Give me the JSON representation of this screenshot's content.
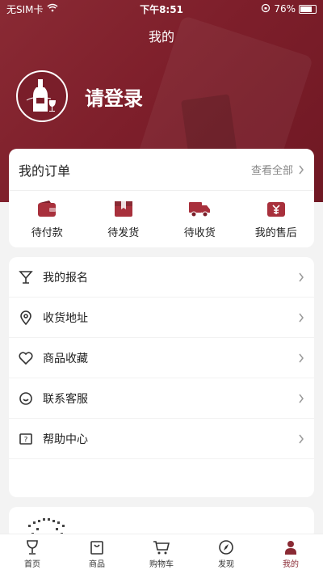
{
  "status_bar": {
    "carrier": "无SIM卡",
    "time": "下午8:51",
    "battery": "76%"
  },
  "header": {
    "title": "我的"
  },
  "profile": {
    "login_text": "请登录"
  },
  "orders": {
    "title": "我的订单",
    "view_all": "查看全部",
    "items": [
      {
        "label": "待付款",
        "icon": "wallet-icon"
      },
      {
        "label": "待发货",
        "icon": "box-icon"
      },
      {
        "label": "待收货",
        "icon": "truck-icon"
      },
      {
        "label": "我的售后",
        "icon": "yen-icon"
      }
    ]
  },
  "menu": {
    "items": [
      {
        "label": "我的报名",
        "icon": "cocktail-glass-icon"
      },
      {
        "label": "收货地址",
        "icon": "location-pin-icon"
      },
      {
        "label": "商品收藏",
        "icon": "heart-icon"
      },
      {
        "label": "联系客服",
        "icon": "customer-service-icon"
      },
      {
        "label": "帮助中心",
        "icon": "help-book-icon"
      }
    ]
  },
  "tabbar": {
    "items": [
      {
        "label": "首页",
        "icon": "wine-glass-icon"
      },
      {
        "label": "商品",
        "icon": "shopping-bag-icon"
      },
      {
        "label": "购物车",
        "icon": "cart-icon"
      },
      {
        "label": "发现",
        "icon": "compass-icon"
      },
      {
        "label": "我的",
        "icon": "user-icon"
      }
    ],
    "active": "我的"
  },
  "colors": {
    "brand": "#8a2a34",
    "background": "#f3f3f3"
  }
}
